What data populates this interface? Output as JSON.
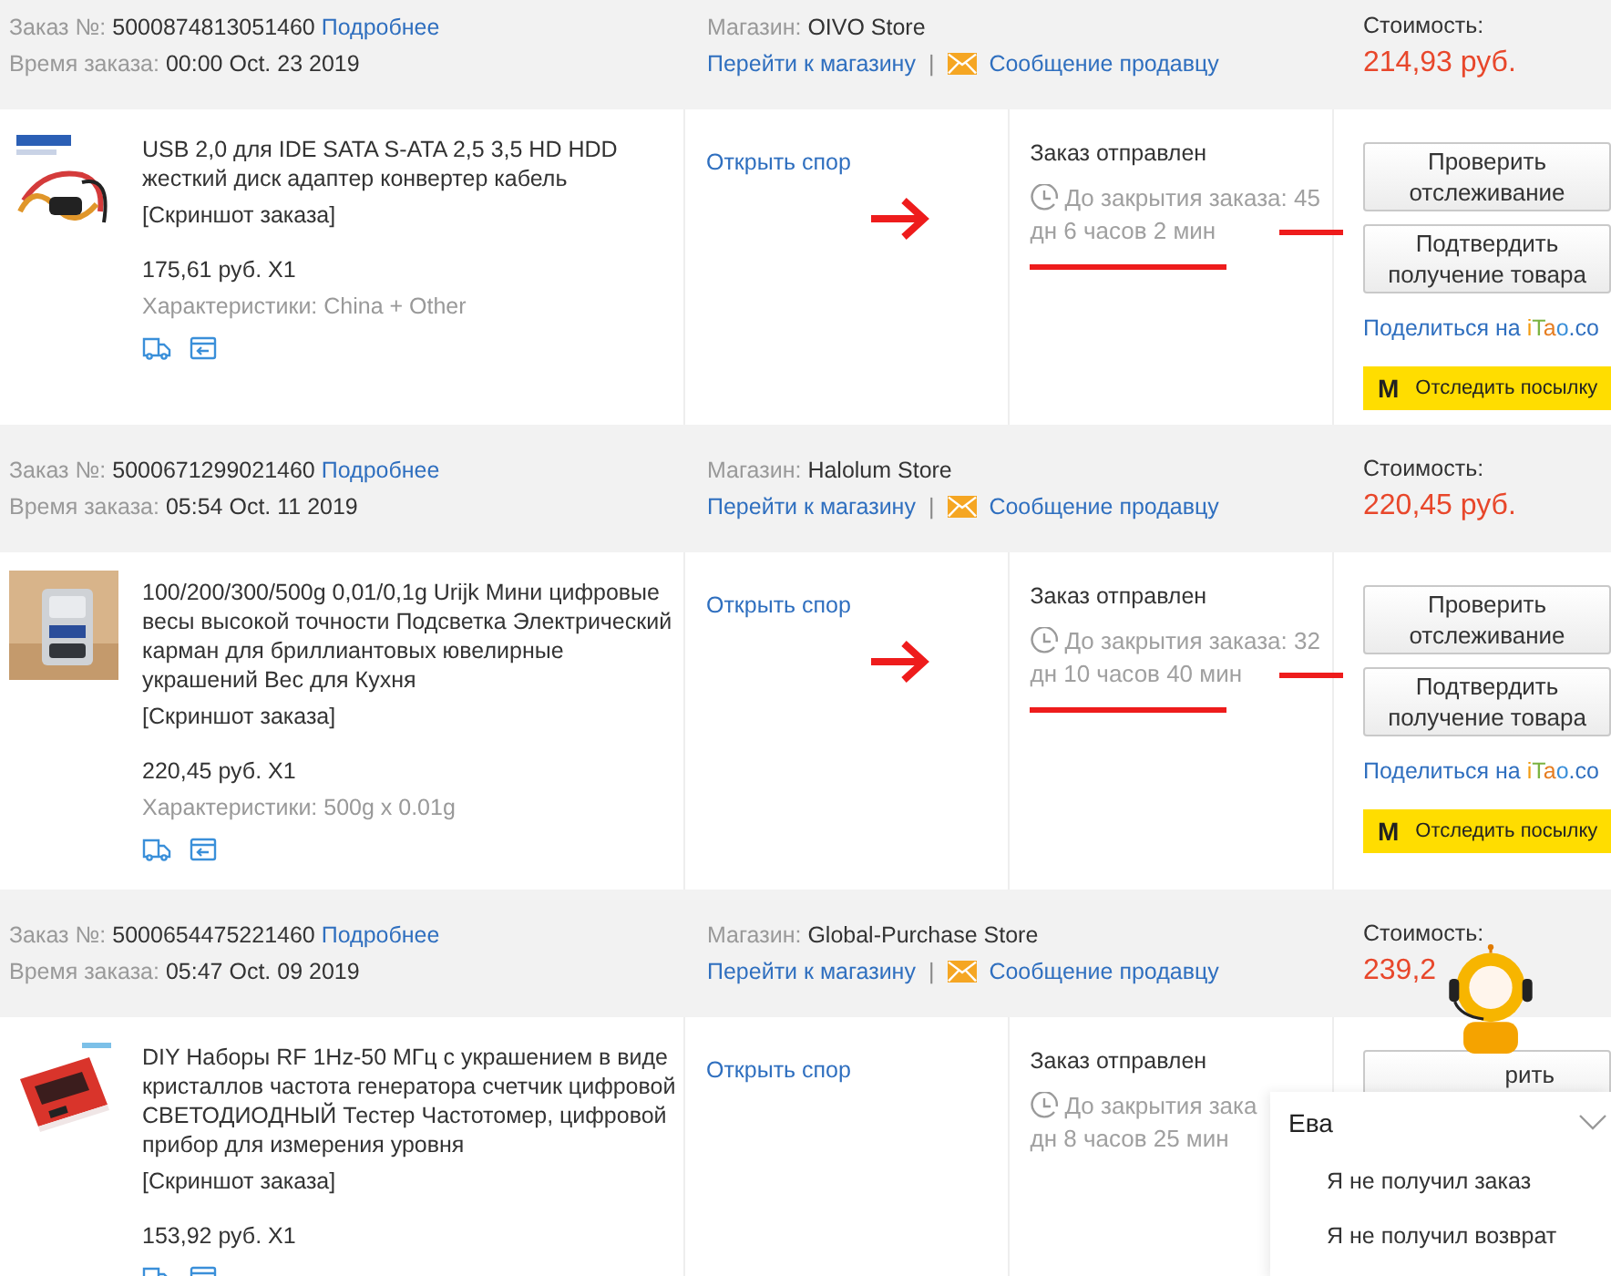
{
  "orders": [
    {
      "order_label": "Заказ №:",
      "order_number": "5000874813051460",
      "details_link": "Подробнее",
      "time_label": "Время заказа:",
      "time": "00:00 Oct. 23 2019",
      "store_label": "Магазин:",
      "store": "OIVO Store",
      "store_link": "Перейти к магазину",
      "separator": "|",
      "message_link": "Сообщение продавцу",
      "cost_label": "Стоимость:",
      "cost": "214,93 руб.",
      "product_title": "USB 2,0 для IDE SATA S-ATA 2,5 3,5 HD HDD жесткий диск адаптер конвертер кабель",
      "snapshot_link": "[Скриншот заказа]",
      "price": "175,61 руб. X1",
      "specs": "Характеристики: China + Other",
      "dispute_link": "Открыть спор",
      "status": "Заказ отправлен",
      "timer": [
        "До закрытия заказа: 45",
        "дн 6 часов 2 мин"
      ],
      "annotated": true,
      "buttons": [
        "Проверить отслеживание",
        "Подтвердить получение товара"
      ],
      "share_prefix": "Поделиться на",
      "share_brand": "iTao",
      "share_suffix": ".co",
      "track_badge": "M",
      "track_label": "Отследить посылку"
    },
    {
      "order_label": "Заказ №:",
      "order_number": "5000671299021460",
      "details_link": "Подробнее",
      "time_label": "Время заказа:",
      "time": "05:54 Oct. 11 2019",
      "store_label": "Магазин:",
      "store": "Halolum Store",
      "store_link": "Перейти к магазину",
      "separator": "|",
      "message_link": "Сообщение продавцу",
      "cost_label": "Стоимость:",
      "cost": "220,45 руб.",
      "product_title": "100/200/300/500g 0,01/0,1g Urijk Мини цифровые весы высокой точности Подсветка Электрический карман для бриллиантовых ювелирные украшений Вес для Кухня",
      "snapshot_link": "[Скриншот заказа]",
      "price": "220,45 руб. X1",
      "specs": "Характеристики: 500g x 0.01g",
      "dispute_link": "Открыть спор",
      "status": "Заказ отправлен",
      "timer": [
        "До закрытия заказа: 32",
        "дн 10 часов 40 мин"
      ],
      "annotated": true,
      "buttons": [
        "Проверить отслеживание",
        "Подтвердить получение товара"
      ],
      "share_prefix": "Поделиться на",
      "share_brand": "iTao",
      "share_suffix": ".co",
      "track_badge": "M",
      "track_label": "Отследить посылку"
    },
    {
      "order_label": "Заказ №:",
      "order_number": "5000654475221460",
      "details_link": "Подробнее",
      "time_label": "Время заказа:",
      "time": "05:47 Oct. 09 2019",
      "store_label": "Магазин:",
      "store": "Global-Purchase Store",
      "store_link": "Перейти к магазину",
      "separator": "|",
      "message_link": "Сообщение продавцу",
      "cost_label": "Стоимость:",
      "cost": "239,2",
      "product_title": "DIY Наборы RF 1Hz-50 МГц с украшением в виде кристаллов частота генератора счетчик цифровой СВЕТОДИОДНЫЙ Тестер Частотомер, цифровой прибор для измерения уровня",
      "snapshot_link": "[Скриншот заказа]",
      "price": "153,92 руб. X1",
      "dispute_link": "Открыть спор",
      "status": "Заказ отправлен",
      "timer": [
        "До закрытия зака",
        "дн 8 часов 25 мин"
      ],
      "annotated": false,
      "buttons": [
        "рить"
      ]
    }
  ],
  "chat": {
    "name": "Ева",
    "items": [
      "Я не получил заказ",
      "Я не получил возврат"
    ]
  }
}
